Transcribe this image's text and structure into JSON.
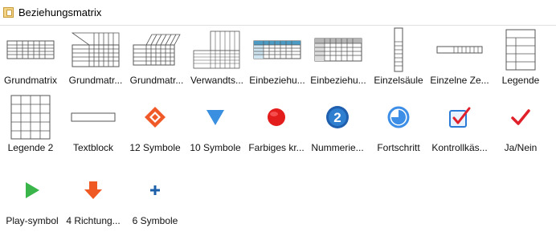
{
  "window": {
    "title": "Beziehungsmatrix",
    "title_icon": "library-icon"
  },
  "shapes": [
    {
      "label": "Grundmatrix",
      "icon": "grid-table-icon"
    },
    {
      "label": "Grundmatr...",
      "icon": "grid-slanted-header-icon"
    },
    {
      "label": "Grundmatr...",
      "icon": "grid-3d-header-icon"
    },
    {
      "label": "Verwandts...",
      "icon": "relationship-matrix-icon"
    },
    {
      "label": "Einbeziehu...",
      "icon": "blue-header-table-icon"
    },
    {
      "label": "Einbeziehu...",
      "icon": "gray-header-table-icon"
    },
    {
      "label": "Einzelsäule",
      "icon": "single-column-icon"
    },
    {
      "label": "Einzelne Ze...",
      "icon": "single-row-icon"
    },
    {
      "label": "Legende",
      "icon": "legend-table-icon"
    },
    {
      "label": "Legende 2",
      "icon": "legend-grid-icon"
    },
    {
      "label": "Textblock",
      "icon": "textblock-icon"
    },
    {
      "label": "12 Symbole",
      "icon": "diamond-icon"
    },
    {
      "label": "10 Symbole",
      "icon": "triangle-down-icon"
    },
    {
      "label": "Farbiges kr...",
      "icon": "red-circle-icon"
    },
    {
      "label": "Nummerie...",
      "icon": "number-badge-icon"
    },
    {
      "label": "Fortschritt",
      "icon": "progress-pie-icon"
    },
    {
      "label": "Kontrollkäs...",
      "icon": "checkbox-icon"
    },
    {
      "label": "Ja/Nein",
      "icon": "checkmark-icon"
    },
    {
      "label": "Play-symbol",
      "icon": "play-icon"
    },
    {
      "label": "4 Richtung...",
      "icon": "arrow-down-icon"
    },
    {
      "label": "6 Symbole",
      "icon": "plus-icon"
    }
  ],
  "badge_number": "2",
  "colors": {
    "grid_line": "#555555",
    "blue_header": "#4a9ac4",
    "gray_header": "#b5b5b5",
    "diamond": "#f05a28",
    "triangle": "#3b8fe0",
    "red_circle": "#e31c1c",
    "number_badge": "#1f5fae",
    "progress": "#3d8ee6",
    "checkbox": "#2b7bd6",
    "check_red": "#e0202a",
    "play": "#39b54a",
    "arrow": "#ef5a24",
    "plus": "#1d5fa8"
  }
}
